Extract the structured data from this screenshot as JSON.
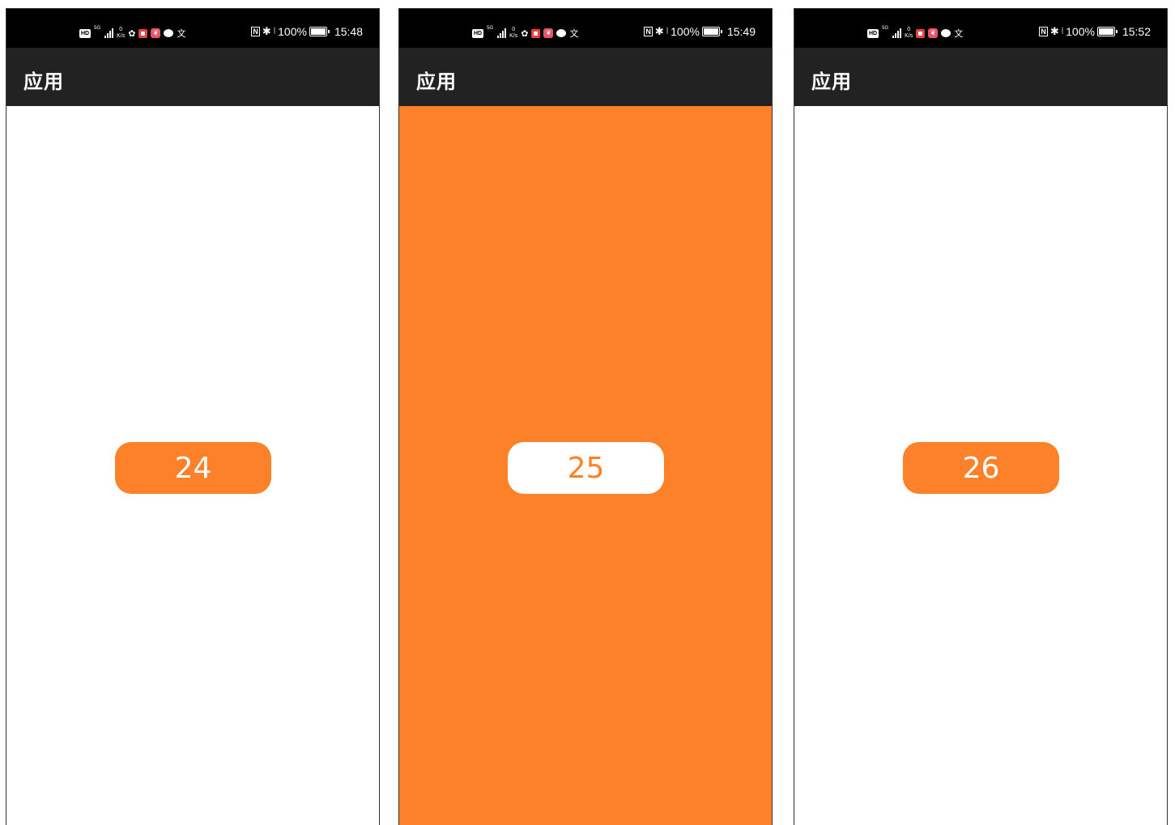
{
  "colors": {
    "accent": "#fd8129",
    "app_bar": "#222222",
    "status_bar": "#000000",
    "white": "#ffffff"
  },
  "screens": [
    {
      "status_bar": {
        "network_type": "5G",
        "speed_value": "0",
        "speed_unit": "K/s",
        "nfc": "N",
        "battery": "100%",
        "time": "15:48",
        "icons": [
          "hd-icon",
          "signal-icon",
          "wechat-icon",
          "red-app-icon",
          "pink-app-icon",
          "chat-bubble-icon",
          "translate-icon",
          "nfc-icon",
          "bluetooth-icon",
          "vibrate-icon",
          "battery-icon"
        ]
      },
      "app_bar": {
        "title": "应用"
      },
      "content": {
        "background": "white",
        "button_label": "24",
        "button_style": "orange"
      }
    },
    {
      "status_bar": {
        "network_type": "5G",
        "speed_value": "0",
        "speed_unit": "K/s",
        "nfc": "N",
        "battery": "100%",
        "time": "15:49",
        "icons": [
          "hd-icon",
          "signal-icon",
          "wechat-icon",
          "red-app-icon",
          "pink-app-icon",
          "chat-bubble-icon",
          "translate-icon",
          "nfc-icon",
          "bluetooth-icon",
          "vibrate-icon",
          "battery-icon"
        ]
      },
      "app_bar": {
        "title": "应用"
      },
      "content": {
        "background": "orange",
        "button_label": "25",
        "button_style": "white"
      }
    },
    {
      "status_bar": {
        "network_type": "5G",
        "speed_value": "0",
        "speed_unit": "K/s",
        "nfc": "N",
        "battery": "100%",
        "time": "15:52",
        "icons": [
          "hd-icon",
          "signal-icon",
          "red-app-icon",
          "pink-app-icon",
          "chat-bubble-icon",
          "translate-icon",
          "nfc-icon",
          "bluetooth-icon",
          "vibrate-icon",
          "battery-icon"
        ]
      },
      "app_bar": {
        "title": "应用"
      },
      "content": {
        "background": "white",
        "button_label": "26",
        "button_style": "orange"
      }
    }
  ]
}
